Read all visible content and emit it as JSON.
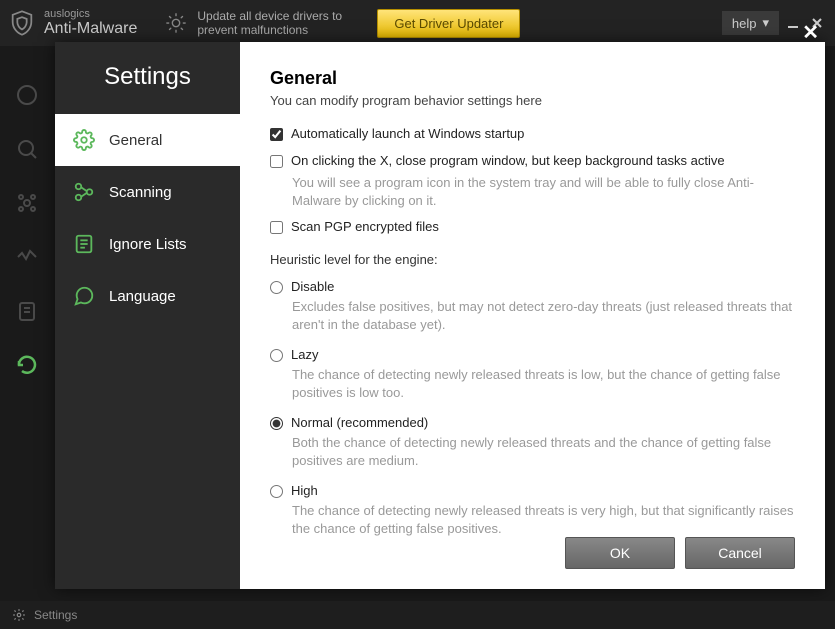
{
  "topbar": {
    "brand": "auslogics",
    "name": "Anti-Malware",
    "update_text": "Update all device drivers to prevent malfunctions",
    "driver_btn": "Get Driver Updater",
    "help": "help"
  },
  "dialog": {
    "title": "Settings",
    "nav": {
      "general": "General",
      "scanning": "Scanning",
      "ignore": "Ignore Lists",
      "language": "Language"
    }
  },
  "content": {
    "title": "General",
    "subtitle": "You can modify program behavior settings here",
    "chk_launch": "Automatically launch at Windows startup",
    "chk_close": "On clicking the X, close program window, but keep background tasks active",
    "chk_close_desc": "You will see a program icon in the system tray and will be able to fully close Anti-Malware by clicking on it.",
    "chk_pgp": "Scan PGP encrypted files",
    "heuristic_title": "Heuristic level for the engine:",
    "radio_disable": "Disable",
    "radio_disable_desc": "Excludes false positives, but may not detect zero-day threats (just released threats that aren't in the database yet).",
    "radio_lazy": "Lazy",
    "radio_lazy_desc": "The chance of detecting newly released threats is low, but the chance of getting false positives is low too.",
    "radio_normal": "Normal (recommended)",
    "radio_normal_desc": "Both the chance of detecting newly released threats and the chance of getting false positives are medium.",
    "radio_high": "High",
    "radio_high_desc": "The chance of detecting newly released threats is very high, but that significantly raises the chance of getting false positives.",
    "ok": "OK",
    "cancel": "Cancel"
  },
  "statusbar": {
    "settings": "Settings"
  }
}
